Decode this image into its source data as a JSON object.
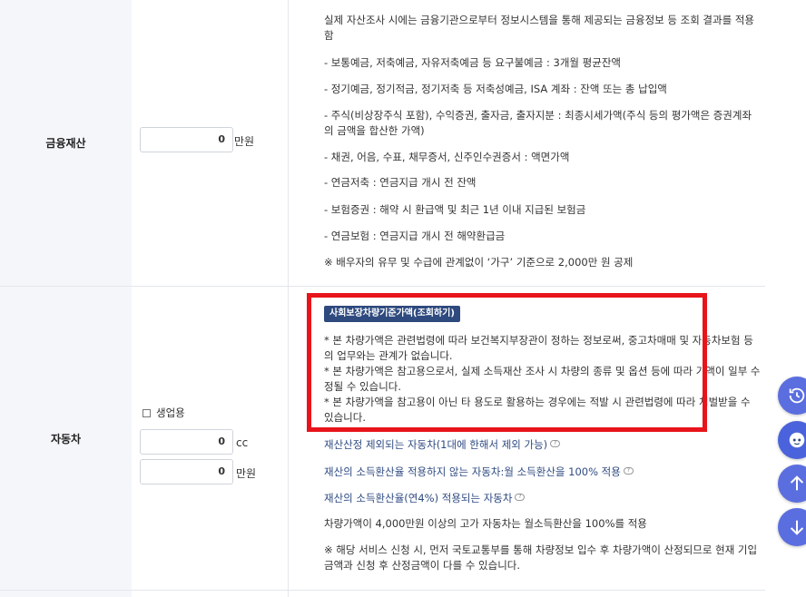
{
  "financial": {
    "label": "금융재산",
    "value": "0",
    "unit": "만원",
    "notes": [
      "실제 자산조사 시에는 금융기관으로부터 정보시스템을 통해 제공되는 금융정보 등 조회 결과를 적용함",
      "- 보통예금, 저축예금, 자유저축예금 등 요구불예금 : 3개월 평균잔액",
      "- 정기예금, 정기적금, 정기저축 등 저축성예금, ISA 계좌 : 잔액 또는 총 납입액",
      "- 주식(비상장주식 포함), 수익증권, 출자금, 출자지분 : 최종시세가액(주식 등의 평가액은 증권계좌의 금액을 합산한 가액)",
      "- 채권, 어음, 수표, 채무증서, 신주인수권증서 : 액면가액",
      "- 연금저축 : 연금지급 개시 전 잔액",
      "- 보험증권 : 해약 시 환급액 및 최근 1년 이내 지급된 보험금",
      "- 연금보험 : 연금지급 개시 전 해약환급금",
      "※ 배우자의 유무 및 수급에 관계없이 ‘가구’ 기준으로 2,000만 원 공제"
    ]
  },
  "car": {
    "label": "자동차",
    "checkbox_label": "생업용",
    "cc_value": "0",
    "cc_unit": "cc",
    "price_value": "0",
    "price_unit": "만원",
    "badge": "사회보장차량기준가액(조회하기)",
    "notes": [
      "* 본 차량가액은 관련법령에 따라 보건복지부장관이 정하는 정보로써, 중고차매매 및 자동차보험 등의 업무와는 관계가 없습니다.",
      "* 본 차량가액은 참고용으로서, 실제 소득재산 조사 시 차량의 종류 및 옵션 등에 따라 가액이 일부 수정될 수 있습니다.",
      "* 본 차량가액을 참고용이 아닌 타 용도로 활용하는 경우에는 적발 시 관련법령에 따라 처벌받을 수 있습니다."
    ],
    "links": [
      "재산산정 제외되는 자동차(1대에 한해서 제외 가능)",
      "재산의 소득환산율 적용하지 않는 자동차:월 소득환산을 100% 적용",
      "재산의 소득환산율(연4%) 적용되는 자동차"
    ],
    "info": [
      "차량가액이 4,000만원 이상의 고가 자동차는 월소득환산을 100%를 적용",
      "※ 해당 서비스 신청 시, 먼저 국토교통부를 통해 차량정보 입수 후 차량가액이 산정되므로 현재 기입금액과 신청 후 산정금액이 다를 수 있습니다."
    ]
  },
  "icons": [
    "history-icon",
    "chatbot-icon",
    "arrow-up-icon",
    "arrow-down-icon"
  ],
  "colors": {
    "highlight": "#e8141b",
    "accent": "#5a6ee0",
    "badge": "#2e4a7e"
  }
}
